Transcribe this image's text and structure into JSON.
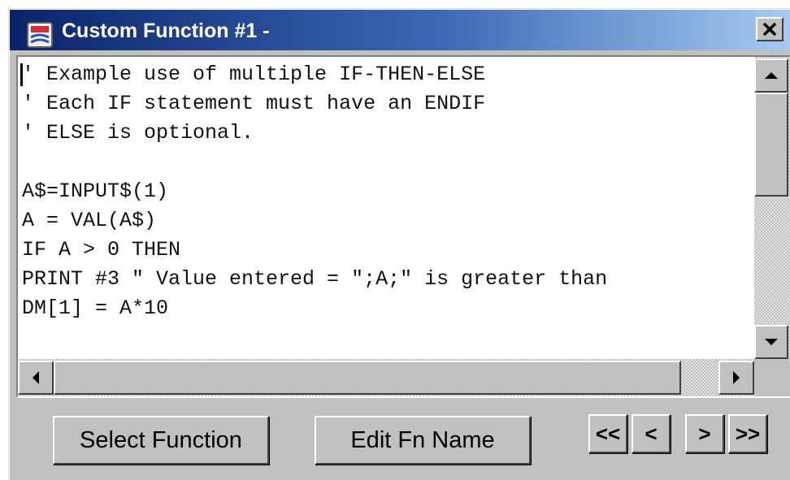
{
  "window": {
    "title": "Custom Function #1 -",
    "icon": "custom-function-app-icon",
    "close_icon": "close-x-icon"
  },
  "editor": {
    "lines": [
      "' Example use of multiple IF-THEN-ELSE",
      "' Each IF statement must have an ENDIF",
      "' ELSE is optional.",
      "",
      "A$=INPUT$(1)",
      "A = VAL(A$)",
      "IF A > 0 THEN",
      "PRINT #3 \" Value entered = \";A;\" is greater than",
      "DM[1] = A*10"
    ]
  },
  "buttons": {
    "select_function": "Select Function",
    "edit_fn_name": "Edit Fn Name",
    "first": "<<",
    "prev": "<",
    "next": ">",
    "last": ">>"
  },
  "colors": {
    "title_start": "#0a246a",
    "title_end": "#a6caf0",
    "face": "#c0c0c0"
  }
}
